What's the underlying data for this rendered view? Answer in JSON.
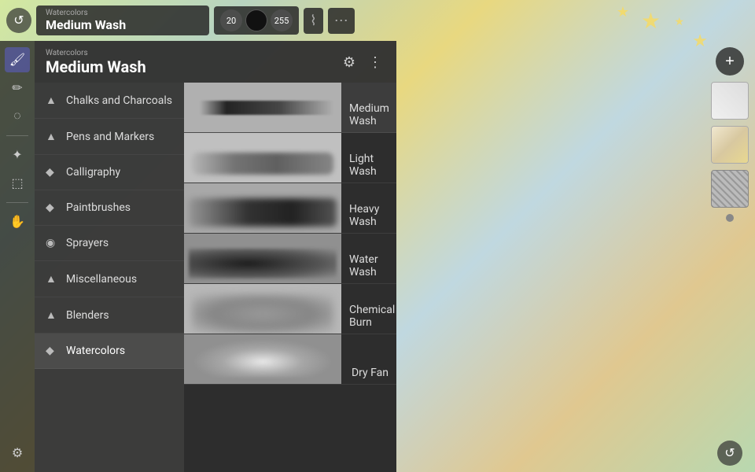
{
  "topBar": {
    "category": "Watercolors",
    "brushName": "Medium Wash",
    "brushSize": "20",
    "opacity": "255",
    "undoLabel": "↺"
  },
  "brushPanel": {
    "categoryLabel": "Watercolors",
    "title": "Medium Wash",
    "gearLabel": "⚙",
    "moreLabel": "⋮",
    "categories": [
      {
        "id": "chalks",
        "icon": "▲",
        "label": "Chalks and Charcoals"
      },
      {
        "id": "pens",
        "icon": "▲",
        "label": "Pens and Markers"
      },
      {
        "id": "calligraphy",
        "icon": "◆",
        "label": "Calligraphy"
      },
      {
        "id": "paintbrushes",
        "icon": "◆",
        "label": "Paintbrushes"
      },
      {
        "id": "sprayers",
        "icon": "◉",
        "label": "Sprayers"
      },
      {
        "id": "miscellaneous",
        "icon": "▲",
        "label": "Miscellaneous"
      },
      {
        "id": "blenders",
        "icon": "▲",
        "label": "Blenders"
      },
      {
        "id": "watercolors",
        "icon": "◆",
        "label": "Watercolors"
      }
    ],
    "brushes": [
      {
        "id": "medium-wash",
        "label": "Medium Wash",
        "previewClass": "preview-medium-wash",
        "selected": true
      },
      {
        "id": "light-wash",
        "label": "Light Wash",
        "previewClass": "preview-light-wash",
        "selected": false
      },
      {
        "id": "heavy-wash",
        "label": "Heavy Wash",
        "previewClass": "preview-heavy-wash",
        "selected": false
      },
      {
        "id": "water-wash",
        "label": "Water Wash",
        "previewClass": "preview-water-wash",
        "selected": false
      },
      {
        "id": "chemical-burn",
        "label": "Chemical Burn",
        "previewClass": "preview-chemical-burn",
        "selected": false
      },
      {
        "id": "dry-fan",
        "label": "Dry Fan",
        "previewClass": "preview-dry-fan",
        "selected": false
      }
    ]
  },
  "leftToolbar": {
    "tools": [
      {
        "id": "paint",
        "icon": "🖌",
        "active": true
      },
      {
        "id": "smudge",
        "icon": "✏",
        "active": false
      },
      {
        "id": "erase",
        "icon": "◯",
        "active": false
      },
      {
        "id": "transform",
        "icon": "✦",
        "active": false
      },
      {
        "id": "select",
        "icon": "⬚",
        "active": false
      },
      {
        "id": "gesture",
        "icon": "✋",
        "active": false
      },
      {
        "id": "settings",
        "icon": "⚙",
        "active": false
      }
    ]
  },
  "rightPanel": {
    "addLabel": "+",
    "undoLabel": "↺",
    "dotColor": "#888"
  }
}
